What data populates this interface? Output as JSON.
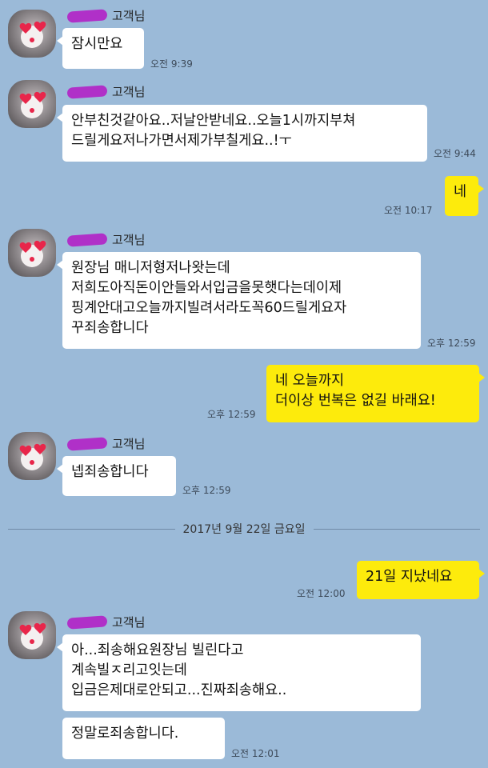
{
  "chat": {
    "sender_name": "고객님",
    "date_separator": "2017년 9월 22일 금요일",
    "messages": {
      "m1": {
        "text": "잠시만요",
        "time": "오전 9:39"
      },
      "m2": {
        "text": "안부친것같아요..저날안받네요..오늘1시까지부쳐\n드릴게요저나가면서제가부칠게요..!ㅜ",
        "time": "오전 9:44"
      },
      "m3": {
        "text": "네",
        "time": "오전 10:17"
      },
      "m4": {
        "text": "원장님 매니저형저나왓는데\n저희도아직돈이안들와서입금을못햇다는데이제\n핑계안대고오늘까지빌려서라도꼭60드릴게요자\n꾸죄송합니다",
        "time": "오후 12:59"
      },
      "m5": {
        "text": "네 오늘까지\n더이상 번복은 없길 바래요!",
        "time": "오후 12:59"
      },
      "m6": {
        "text": "넵죄송합니다",
        "time": "오후 12:59"
      },
      "m7": {
        "text": "21일 지났네요",
        "time": "오전 12:00"
      },
      "m8": {
        "text": "아...죄송해요원장님 빌린다고\n계속빌ㅈ리고잇는데\n입금은제대로안되고...진짜죄송해요..",
        "time": ""
      },
      "m9": {
        "text": "정말로죄송합니다.",
        "time": "오전 12:01"
      }
    }
  },
  "colors": {
    "background": "#9bbad8",
    "incoming_bubble": "#ffffff",
    "outgoing_bubble": "#fdeb0c",
    "name_redaction": "#b030c8"
  }
}
